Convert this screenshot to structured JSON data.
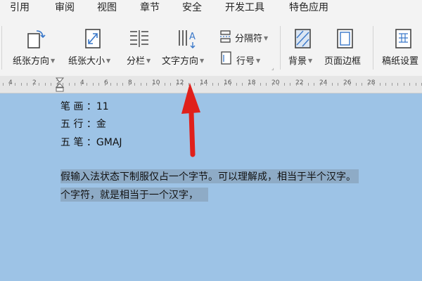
{
  "menu": [
    "引用",
    "审阅",
    "视图",
    "章节",
    "安全",
    "开发工具",
    "特色应用"
  ],
  "ribbon": {
    "orientation": "纸张方向",
    "size": "纸张大小",
    "columns": "分栏",
    "text_direction": "文字方向",
    "separator": "分隔符",
    "line_number": "行号",
    "background": "背景",
    "page_border": "页面边框",
    "manuscript": "稿纸设置"
  },
  "ruler_labels": [
    "4",
    "2",
    "2",
    "4",
    "6",
    "8",
    "10",
    "12",
    "14",
    "16",
    "18",
    "20",
    "22",
    "24",
    "26",
    "28"
  ],
  "document": {
    "line1": "笔  画 ：11",
    "line2": "五  行 ：金",
    "line3": "五  笔 ：GMAJ",
    "para_line1": "假输入法状态下制服仅占一个字节。可以理解成，相当于半个汉字。",
    "para_line2": "个字符，就是相当于一个汉字，"
  },
  "colors": {
    "accent_arrow": "#e0201b",
    "selection": "#8eabc6",
    "page": "#9dc3e6"
  }
}
